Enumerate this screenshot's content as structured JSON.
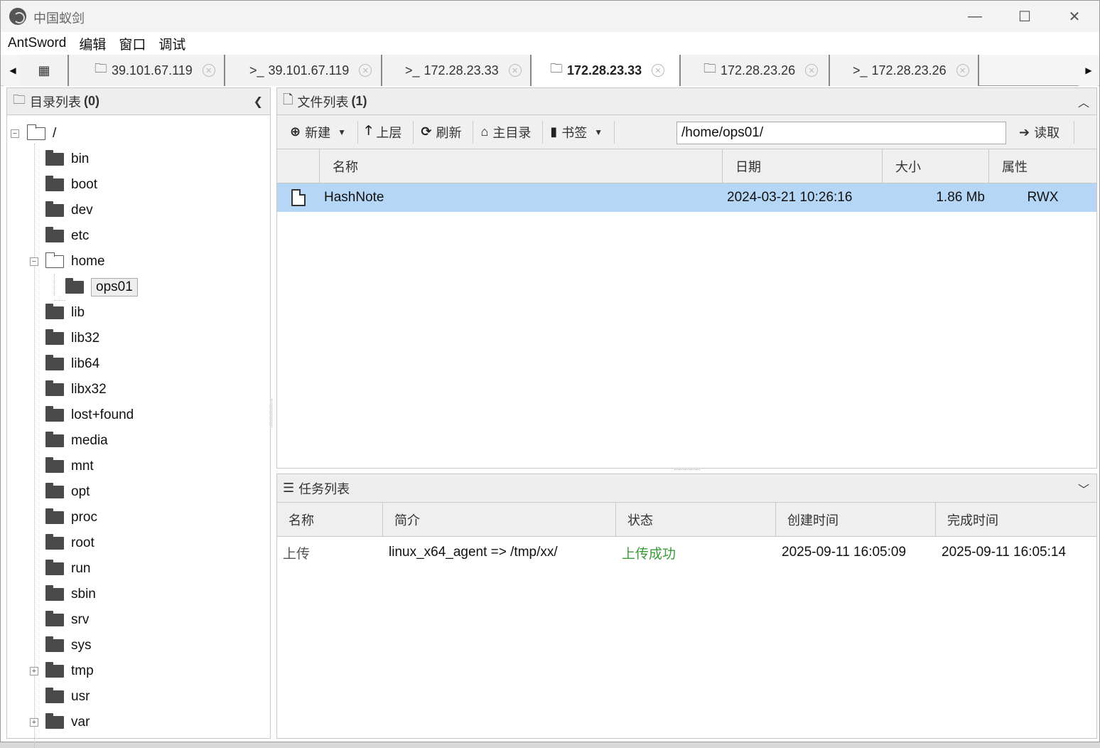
{
  "window": {
    "title": "中国蚁剑",
    "controls": {
      "minimize": "—",
      "maximize": "☐",
      "close": "✕"
    }
  },
  "menu": {
    "items": [
      "AntSword",
      "编辑",
      "窗口",
      "调试"
    ]
  },
  "tabs": [
    {
      "icon": "folder-icon",
      "label": "39.101.67.119",
      "active": false
    },
    {
      "icon": "terminal-icon",
      "label": "39.101.67.119",
      "active": false
    },
    {
      "icon": "terminal-icon",
      "label": "172.28.23.33",
      "active": false
    },
    {
      "icon": "folder-icon",
      "label": "172.28.23.33",
      "active": true
    },
    {
      "icon": "folder-icon",
      "label": "172.28.23.26",
      "active": false
    },
    {
      "icon": "terminal-icon",
      "label": "172.28.23.26",
      "active": false
    }
  ],
  "dir_panel": {
    "title": "目录列表",
    "count": "(0)",
    "root": "/",
    "items": [
      "bin",
      "boot",
      "dev",
      "etc",
      "home",
      "ops01",
      "lib",
      "lib32",
      "lib64",
      "libx32",
      "lost+found",
      "media",
      "mnt",
      "opt",
      "proc",
      "root",
      "run",
      "sbin",
      "srv",
      "sys",
      "tmp",
      "usr",
      "var"
    ]
  },
  "file_panel": {
    "title": "文件列表",
    "count": "(1)",
    "toolbar": {
      "new": "新建",
      "up": "上层",
      "refresh": "刷新",
      "home": "主目录",
      "bookmark": "书签",
      "read": "读取"
    },
    "path": "/home/ops01/",
    "columns": [
      "名称",
      "日期",
      "大小",
      "属性"
    ],
    "rows": [
      {
        "name": "HashNote",
        "date": "2024-03-21 10:26:16",
        "size": "1.86 Mb",
        "attr": "RWX"
      }
    ]
  },
  "task_panel": {
    "title": "任务列表",
    "columns": [
      "名称",
      "简介",
      "状态",
      "创建时间",
      "完成时间"
    ],
    "rows": [
      {
        "name": "上传",
        "desc": "linux_x64_agent => /tmp/xx/",
        "status": "上传成功",
        "created": "2025-09-11 16:05:09",
        "finished": "2025-09-11 16:05:14"
      }
    ]
  },
  "colors": {
    "selected_row": "#b5d6f5",
    "status_success": "#3a9b3a"
  }
}
